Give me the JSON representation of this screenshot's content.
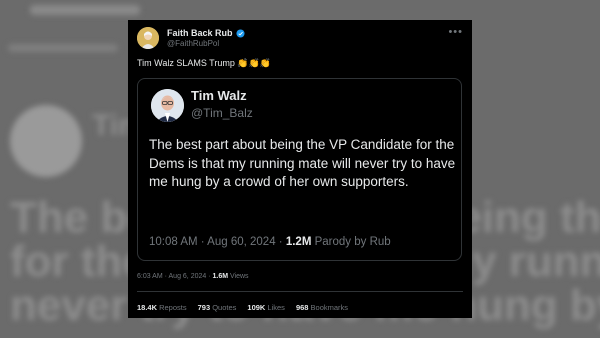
{
  "post": {
    "author_name": "Faith Back Rub",
    "author_handle": "@FaithRubPol",
    "text": "Tim Walz SLAMS Trump",
    "emojis": "👏👏👏",
    "more_icon": "ellipsis-icon",
    "verified_color": "#1d9bf0"
  },
  "quoted": {
    "name": "Tim Walz",
    "handle": "@Tim_Balz",
    "text": "The best part about being the VP Candidate for the Dems is that my running mate will never try to have me hung by a crowd of her own supporters.",
    "time": "10:08 AM · Aug 60, 2024 · ",
    "views": "1.2M",
    "suffix": " Parody by Rub"
  },
  "meta": {
    "time": "6:03 AM · Aug 6, 2024 · ",
    "views": "1.6M",
    "views_label": " Views"
  },
  "stats": {
    "reposts": "18.4K",
    "reposts_label": " Reposts",
    "quotes": "793",
    "quotes_label": " Quotes",
    "likes": "109K",
    "likes_label": " Likes",
    "bookmarks": "968",
    "bookmarks_label": " Bookmarks"
  },
  "background": {
    "line1": "The best part about being the VP Candidate",
    "line2": "for the Dems is that my running mate will",
    "line3": "never try to have me hung by a crowd of her",
    "name": "Tim Walz"
  }
}
